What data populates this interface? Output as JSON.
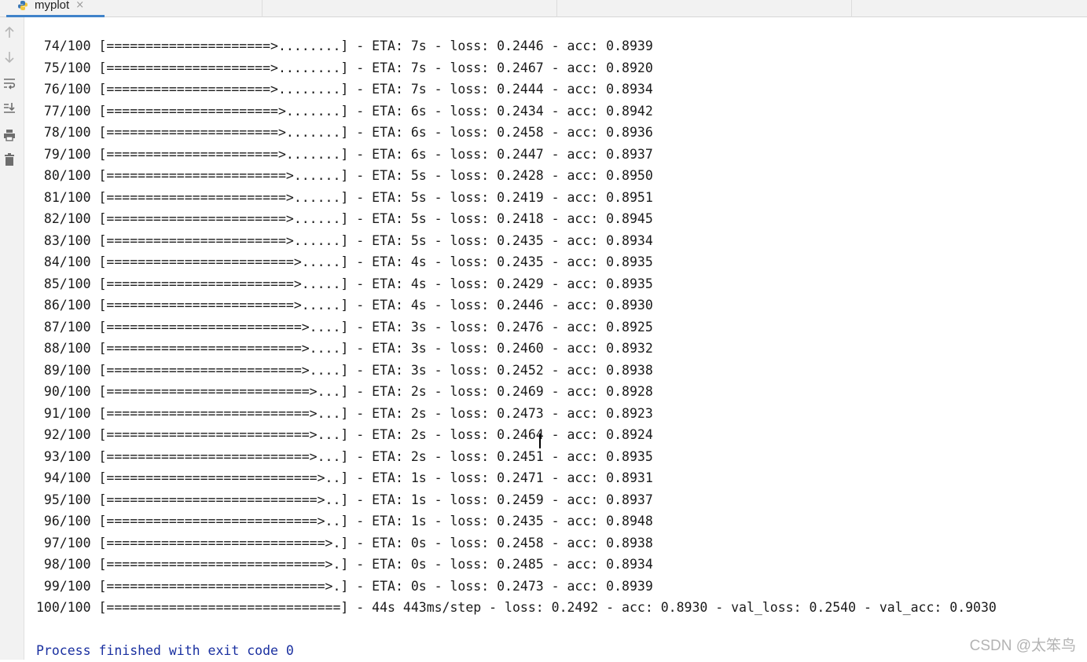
{
  "tab": {
    "title": "myplot",
    "close": "×"
  },
  "gutter": {
    "icons": [
      "arrow-up-icon",
      "arrow-down-icon",
      "soft-wrap-icon",
      "scroll-to-end-icon",
      "print-icon",
      "trash-icon"
    ]
  },
  "console": {
    "lines": [
      " 74/100 [=====================>........] - ETA: 7s - loss: 0.2446 - acc: 0.8939",
      " 75/100 [=====================>........] - ETA: 7s - loss: 0.2467 - acc: 0.8920",
      " 76/100 [=====================>........] - ETA: 7s - loss: 0.2444 - acc: 0.8934",
      " 77/100 [======================>.......] - ETA: 6s - loss: 0.2434 - acc: 0.8942",
      " 78/100 [======================>.......] - ETA: 6s - loss: 0.2458 - acc: 0.8936",
      " 79/100 [======================>.......] - ETA: 6s - loss: 0.2447 - acc: 0.8937",
      " 80/100 [=======================>......] - ETA: 5s - loss: 0.2428 - acc: 0.8950",
      " 81/100 [=======================>......] - ETA: 5s - loss: 0.2419 - acc: 0.8951",
      " 82/100 [=======================>......] - ETA: 5s - loss: 0.2418 - acc: 0.8945",
      " 83/100 [=======================>......] - ETA: 5s - loss: 0.2435 - acc: 0.8934",
      " 84/100 [========================>.....] - ETA: 4s - loss: 0.2435 - acc: 0.8935",
      " 85/100 [========================>.....] - ETA: 4s - loss: 0.2429 - acc: 0.8935",
      " 86/100 [========================>.....] - ETA: 4s - loss: 0.2446 - acc: 0.8930",
      " 87/100 [=========================>....] - ETA: 3s - loss: 0.2476 - acc: 0.8925",
      " 88/100 [=========================>....] - ETA: 3s - loss: 0.2460 - acc: 0.8932",
      " 89/100 [=========================>....] - ETA: 3s - loss: 0.2452 - acc: 0.8938",
      " 90/100 [==========================>...] - ETA: 2s - loss: 0.2469 - acc: 0.8928",
      " 91/100 [==========================>...] - ETA: 2s - loss: 0.2473 - acc: 0.8923",
      " 92/100 [==========================>...] - ETA: 2s - loss: 0.2464 - acc: 0.8924",
      " 93/100 [==========================>...] - ETA: 2s - loss: 0.2451 - acc: 0.8935",
      " 94/100 [===========================>..] - ETA: 1s - loss: 0.2471 - acc: 0.8931",
      " 95/100 [===========================>..] - ETA: 1s - loss: 0.2459 - acc: 0.8937",
      " 96/100 [===========================>..] - ETA: 1s - loss: 0.2435 - acc: 0.8948",
      " 97/100 [============================>.] - ETA: 0s - loss: 0.2458 - acc: 0.8938",
      " 98/100 [============================>.] - ETA: 0s - loss: 0.2485 - acc: 0.8934",
      " 99/100 [============================>.] - ETA: 0s - loss: 0.2473 - acc: 0.8939",
      "100/100 [==============================] - 44s 443ms/step - loss: 0.2492 - acc: 0.8930 - val_loss: 0.2540 - val_acc: 0.9030"
    ],
    "blank": "",
    "process_message": "Process finished with exit code 0"
  },
  "watermark": "CSDN @太笨鸟",
  "colors": {
    "tab_accent": "#4083c9",
    "process_text": "#1a30a0",
    "console_text": "#1a1a1a"
  }
}
